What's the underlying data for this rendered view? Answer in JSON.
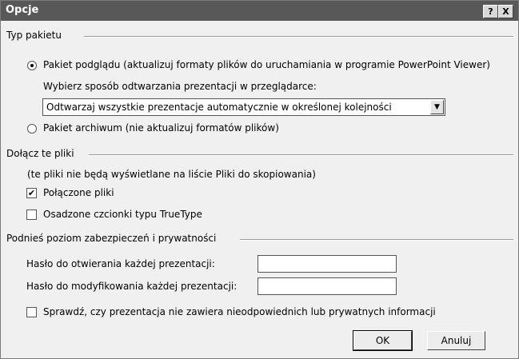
{
  "window": {
    "title": "Opcje",
    "help_label": "?",
    "close_label": "X"
  },
  "package_type": {
    "heading": "Typ pakietu",
    "viewer_radio_label": "Pakiet podglądu (aktualizuj formaty plików do uruchamiania w programie PowerPoint Viewer)",
    "browser_choice_label": "Wybierz sposób odtwarzania prezentacji w przeglądarce:",
    "playback_select_value": "Odtwarzaj wszystkie prezentacje automatycznie w określonej kolejności",
    "archive_radio_label": "Pakiet archiwum (nie aktualizuj formatów plików)",
    "selected": "viewer"
  },
  "include_files": {
    "heading": "Dołącz te pliki",
    "note": "(te pliki nie będą wyświetlane na liście Pliki do skopiowania)",
    "linked_files_label": "Połączone pliki",
    "linked_files_checked": true,
    "embedded_fonts_label": "Osadzone czcionki typu TrueType",
    "embedded_fonts_checked": false
  },
  "security": {
    "heading": "Podnieś poziom zabezpieczeń i prywatności",
    "open_password_label": "Hasło do otwierania każdej prezentacji:",
    "open_password_value": "",
    "modify_password_label": "Hasło do modyfikowania każdej prezentacji:",
    "modify_password_value": "",
    "inspect_label": "Sprawdź, czy prezentacja nie zawiera nieodpowiednich lub prywatnych informacji",
    "inspect_checked": false
  },
  "buttons": {
    "ok_label": "OK",
    "cancel_label": "Anuluj"
  },
  "icons": {
    "check": "✔",
    "dropdown": "▼"
  }
}
